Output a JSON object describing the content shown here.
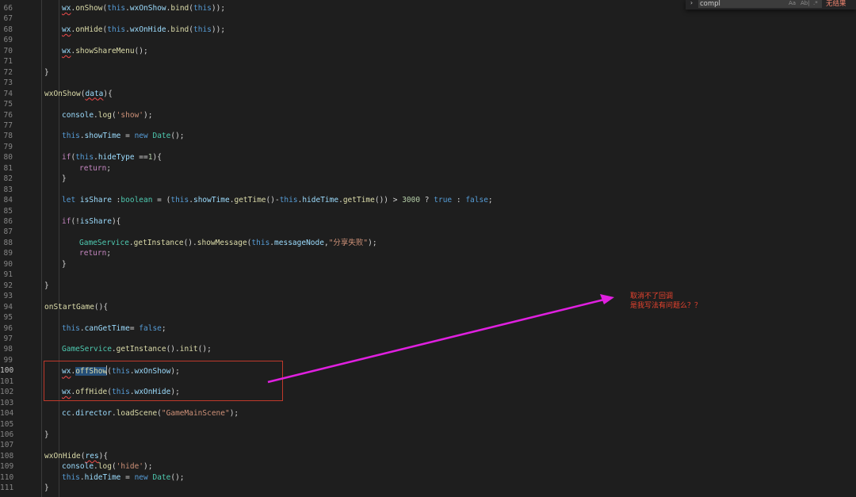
{
  "editor": {
    "lines": [
      {
        "n": "66",
        "indent": 2,
        "tokens": [
          [
            "wx",
            "var squiggle"
          ],
          [
            ".",
            "plain"
          ],
          [
            "onShow",
            "fn"
          ],
          [
            "(",
            "plain"
          ],
          [
            "this",
            "kw"
          ],
          [
            ".",
            "plain"
          ],
          [
            "wxOnShow",
            "var"
          ],
          [
            ".",
            "plain"
          ],
          [
            "bind",
            "fn"
          ],
          [
            "(",
            "plain"
          ],
          [
            "this",
            "kw"
          ],
          [
            "));",
            "plain"
          ]
        ]
      },
      {
        "n": "67",
        "indent": 0,
        "tokens": []
      },
      {
        "n": "68",
        "indent": 2,
        "tokens": [
          [
            "wx",
            "var squiggle"
          ],
          [
            ".",
            "plain"
          ],
          [
            "onHide",
            "fn"
          ],
          [
            "(",
            "plain"
          ],
          [
            "this",
            "kw"
          ],
          [
            ".",
            "plain"
          ],
          [
            "wxOnHide",
            "var"
          ],
          [
            ".",
            "plain"
          ],
          [
            "bind",
            "fn"
          ],
          [
            "(",
            "plain"
          ],
          [
            "this",
            "kw"
          ],
          [
            "));",
            "plain"
          ]
        ]
      },
      {
        "n": "69",
        "indent": 0,
        "tokens": []
      },
      {
        "n": "70",
        "indent": 2,
        "tokens": [
          [
            "wx",
            "var squiggle"
          ],
          [
            ".",
            "plain"
          ],
          [
            "showShareMenu",
            "fn"
          ],
          [
            "();",
            "plain"
          ]
        ]
      },
      {
        "n": "71",
        "indent": 0,
        "tokens": []
      },
      {
        "n": "72",
        "indent": 1,
        "tokens": [
          [
            "}",
            "plain"
          ]
        ]
      },
      {
        "n": "73",
        "indent": 0,
        "tokens": []
      },
      {
        "n": "74",
        "indent": 1,
        "tokens": [
          [
            "wxOnShow",
            "fn"
          ],
          [
            "(",
            "plain"
          ],
          [
            "data",
            "var squiggle"
          ],
          [
            "){",
            "plain"
          ]
        ]
      },
      {
        "n": "75",
        "indent": 0,
        "tokens": []
      },
      {
        "n": "76",
        "indent": 2,
        "tokens": [
          [
            "console",
            "var"
          ],
          [
            ".",
            "plain"
          ],
          [
            "log",
            "fn"
          ],
          [
            "(",
            "plain"
          ],
          [
            "'show'",
            "str"
          ],
          [
            ");",
            "plain"
          ]
        ]
      },
      {
        "n": "77",
        "indent": 0,
        "tokens": []
      },
      {
        "n": "78",
        "indent": 2,
        "tokens": [
          [
            "this",
            "kw"
          ],
          [
            ".",
            "plain"
          ],
          [
            "showTime",
            "var"
          ],
          [
            " = ",
            "plain"
          ],
          [
            "new",
            "kw"
          ],
          [
            " ",
            "plain"
          ],
          [
            "Date",
            "type"
          ],
          [
            "();",
            "plain"
          ]
        ]
      },
      {
        "n": "79",
        "indent": 0,
        "tokens": []
      },
      {
        "n": "80",
        "indent": 2,
        "tokens": [
          [
            "if",
            "ctl"
          ],
          [
            "(",
            "plain"
          ],
          [
            "this",
            "kw"
          ],
          [
            ".",
            "plain"
          ],
          [
            "hideType",
            "var"
          ],
          [
            " ==",
            "plain"
          ],
          [
            "1",
            "num"
          ],
          [
            "){",
            "plain"
          ]
        ]
      },
      {
        "n": "81",
        "indent": 3,
        "tokens": [
          [
            "return",
            "ctl"
          ],
          [
            ";",
            "plain"
          ]
        ]
      },
      {
        "n": "82",
        "indent": 2,
        "tokens": [
          [
            "}",
            "plain"
          ]
        ]
      },
      {
        "n": "83",
        "indent": 0,
        "tokens": []
      },
      {
        "n": "84",
        "indent": 2,
        "tokens": [
          [
            "let",
            "kw"
          ],
          [
            " ",
            "plain"
          ],
          [
            "isShare",
            "var"
          ],
          [
            " :",
            "plain"
          ],
          [
            "boolean",
            "type"
          ],
          [
            " = (",
            "plain"
          ],
          [
            "this",
            "kw"
          ],
          [
            ".",
            "plain"
          ],
          [
            "showTime",
            "var"
          ],
          [
            ".",
            "plain"
          ],
          [
            "getTime",
            "fn"
          ],
          [
            "()-",
            "plain"
          ],
          [
            "this",
            "kw"
          ],
          [
            ".",
            "plain"
          ],
          [
            "hideTime",
            "var"
          ],
          [
            ".",
            "plain"
          ],
          [
            "getTime",
            "fn"
          ],
          [
            "()) > ",
            "plain"
          ],
          [
            "3000",
            "num"
          ],
          [
            " ? ",
            "plain"
          ],
          [
            "true",
            "kw"
          ],
          [
            " : ",
            "plain"
          ],
          [
            "false",
            "kw"
          ],
          [
            ";",
            "plain"
          ]
        ]
      },
      {
        "n": "85",
        "indent": 0,
        "tokens": []
      },
      {
        "n": "86",
        "indent": 2,
        "tokens": [
          [
            "if",
            "ctl"
          ],
          [
            "(!",
            "plain"
          ],
          [
            "isShare",
            "var"
          ],
          [
            "){",
            "plain"
          ]
        ]
      },
      {
        "n": "87",
        "indent": 0,
        "tokens": []
      },
      {
        "n": "88",
        "indent": 3,
        "tokens": [
          [
            "GameService",
            "type"
          ],
          [
            ".",
            "plain"
          ],
          [
            "getInstance",
            "fn"
          ],
          [
            "().",
            "plain"
          ],
          [
            "showMessage",
            "fn"
          ],
          [
            "(",
            "plain"
          ],
          [
            "this",
            "kw"
          ],
          [
            ".",
            "plain"
          ],
          [
            "messageNode",
            "var"
          ],
          [
            ",",
            "plain"
          ],
          [
            "\"分享失败\"",
            "str"
          ],
          [
            ");",
            "plain"
          ]
        ]
      },
      {
        "n": "89",
        "indent": 3,
        "tokens": [
          [
            "return",
            "ctl"
          ],
          [
            ";",
            "plain"
          ]
        ]
      },
      {
        "n": "90",
        "indent": 2,
        "tokens": [
          [
            "}",
            "plain"
          ]
        ]
      },
      {
        "n": "91",
        "indent": 0,
        "tokens": []
      },
      {
        "n": "92",
        "indent": 1,
        "tokens": [
          [
            "}",
            "plain"
          ]
        ]
      },
      {
        "n": "93",
        "indent": 0,
        "tokens": []
      },
      {
        "n": "94",
        "indent": 1,
        "tokens": [
          [
            "onStartGame",
            "fn"
          ],
          [
            "(){",
            "plain"
          ]
        ]
      },
      {
        "n": "95",
        "indent": 0,
        "tokens": []
      },
      {
        "n": "96",
        "indent": 2,
        "tokens": [
          [
            "this",
            "kw"
          ],
          [
            ".",
            "plain"
          ],
          [
            "canGetTime",
            "var"
          ],
          [
            "= ",
            "plain"
          ],
          [
            "false",
            "kw"
          ],
          [
            ";",
            "plain"
          ]
        ]
      },
      {
        "n": "97",
        "indent": 0,
        "tokens": []
      },
      {
        "n": "98",
        "indent": 2,
        "tokens": [
          [
            "GameService",
            "type"
          ],
          [
            ".",
            "plain"
          ],
          [
            "getInstance",
            "fn"
          ],
          [
            "().",
            "plain"
          ],
          [
            "init",
            "fn"
          ],
          [
            "();",
            "plain"
          ]
        ]
      },
      {
        "n": "99",
        "indent": 0,
        "tokens": []
      },
      {
        "n": "100",
        "indent": 2,
        "active": true,
        "tokens": [
          [
            "wx",
            "var squiggle"
          ],
          [
            ".",
            "plain"
          ],
          [
            "offShow",
            "fn hl"
          ],
          [
            "|",
            "cursor"
          ],
          [
            "(",
            "plain"
          ],
          [
            "this",
            "kw"
          ],
          [
            ".",
            "plain"
          ],
          [
            "wxOnShow",
            "var"
          ],
          [
            ");",
            "plain"
          ]
        ]
      },
      {
        "n": "101",
        "indent": 0,
        "tokens": []
      },
      {
        "n": "102",
        "indent": 2,
        "tokens": [
          [
            "wx",
            "var squiggle"
          ],
          [
            ".",
            "plain"
          ],
          [
            "offHide",
            "fn"
          ],
          [
            "(",
            "plain"
          ],
          [
            "this",
            "kw"
          ],
          [
            ".",
            "plain"
          ],
          [
            "wxOnHide",
            "var"
          ],
          [
            ");",
            "plain"
          ]
        ]
      },
      {
        "n": "103",
        "indent": 0,
        "tokens": []
      },
      {
        "n": "104",
        "indent": 2,
        "tokens": [
          [
            "cc",
            "var"
          ],
          [
            ".",
            "plain"
          ],
          [
            "director",
            "var"
          ],
          [
            ".",
            "plain"
          ],
          [
            "loadScene",
            "fn"
          ],
          [
            "(",
            "plain"
          ],
          [
            "\"GameMainScene\"",
            "str"
          ],
          [
            ");",
            "plain"
          ]
        ]
      },
      {
        "n": "105",
        "indent": 0,
        "tokens": []
      },
      {
        "n": "106",
        "indent": 1,
        "tokens": [
          [
            "}",
            "plain"
          ]
        ]
      },
      {
        "n": "107",
        "indent": 0,
        "tokens": []
      },
      {
        "n": "108",
        "indent": 1,
        "tokens": [
          [
            "wxOnHide",
            "fn"
          ],
          [
            "(",
            "plain"
          ],
          [
            "res",
            "var squiggle"
          ],
          [
            "){",
            "plain"
          ]
        ]
      },
      {
        "n": "109",
        "indent": 2,
        "tokens": [
          [
            "console",
            "var"
          ],
          [
            ".",
            "plain"
          ],
          [
            "log",
            "fn"
          ],
          [
            "(",
            "plain"
          ],
          [
            "'hide'",
            "str"
          ],
          [
            ");",
            "plain"
          ]
        ]
      },
      {
        "n": "110",
        "indent": 2,
        "tokens": [
          [
            "this",
            "kw"
          ],
          [
            ".",
            "plain"
          ],
          [
            "hideTime",
            "var"
          ],
          [
            " = ",
            "plain"
          ],
          [
            "new",
            "kw"
          ],
          [
            " ",
            "plain"
          ],
          [
            "Date",
            "type"
          ],
          [
            "();",
            "plain"
          ]
        ]
      },
      {
        "n": "111",
        "indent": 1,
        "tokens": [
          [
            "}",
            "plain"
          ]
        ]
      }
    ]
  },
  "annotation": {
    "line1": "取消不了回调",
    "line2": "是我写法有问题么？？",
    "color": "#e8432e",
    "arrow_color": "#e020e0"
  },
  "find": {
    "toggle_icon": "chevron-right-icon",
    "toggle_glyph": "›",
    "value": "compl",
    "match_case_label": "Aa",
    "whole_word_label": "Ab|",
    "regex_icon": "regex-icon",
    "regex_glyph": ".*",
    "status": "无结果"
  }
}
